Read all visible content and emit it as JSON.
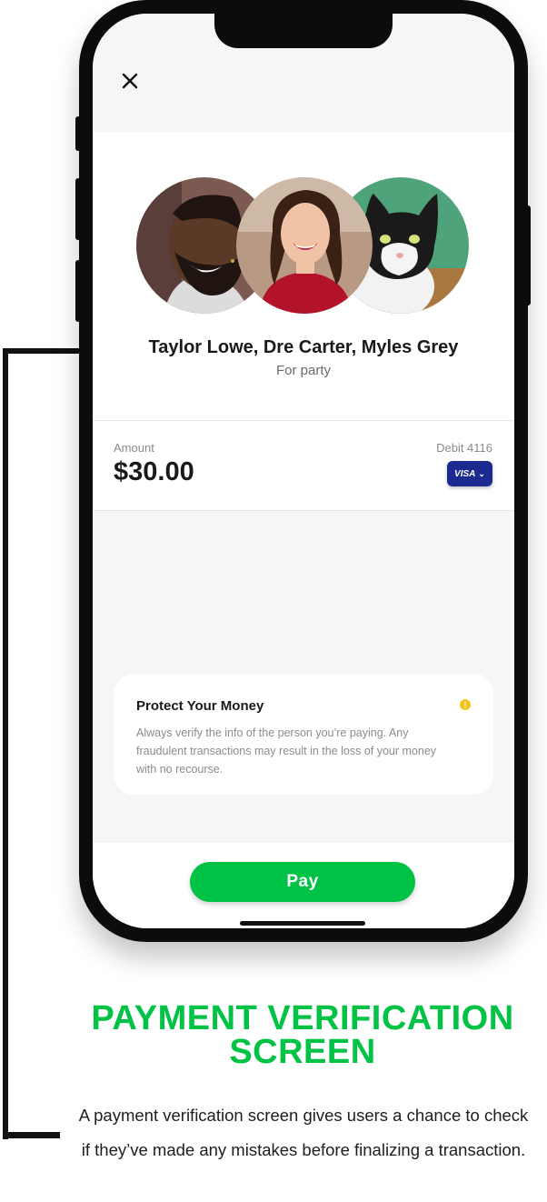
{
  "header": {
    "close_icon": "close-icon"
  },
  "recipients": {
    "names": "Taylor Lowe, Dre Carter, Myles Grey",
    "memo": "For party",
    "avatars": [
      "avatar-man-portrait",
      "avatar-woman-portrait",
      "avatar-cat-portrait"
    ]
  },
  "payment": {
    "amount_label": "Amount",
    "amount_value": "$30.00",
    "card_label": "Debit 4116",
    "card_brand": "VISA",
    "card_dropdown_icon": "chevron-down-icon"
  },
  "notice": {
    "title": "Protect Your Money",
    "icon": "info-icon",
    "text": "Always verify the info of the person you’re paying. Any fraudulent transactions may result in the loss of your money with no recourse."
  },
  "actions": {
    "pay_label": "Pay"
  },
  "caption": {
    "headline": "PAYMENT VERIFICATION SCREEN",
    "description": "A payment verification screen gives users a chance to check if they’ve made any mistakes before finalizing a transaction."
  },
  "colors": {
    "accent_green": "#00c244",
    "card_blue": "#1b2a8f",
    "warning_yellow": "#f6c21c"
  }
}
